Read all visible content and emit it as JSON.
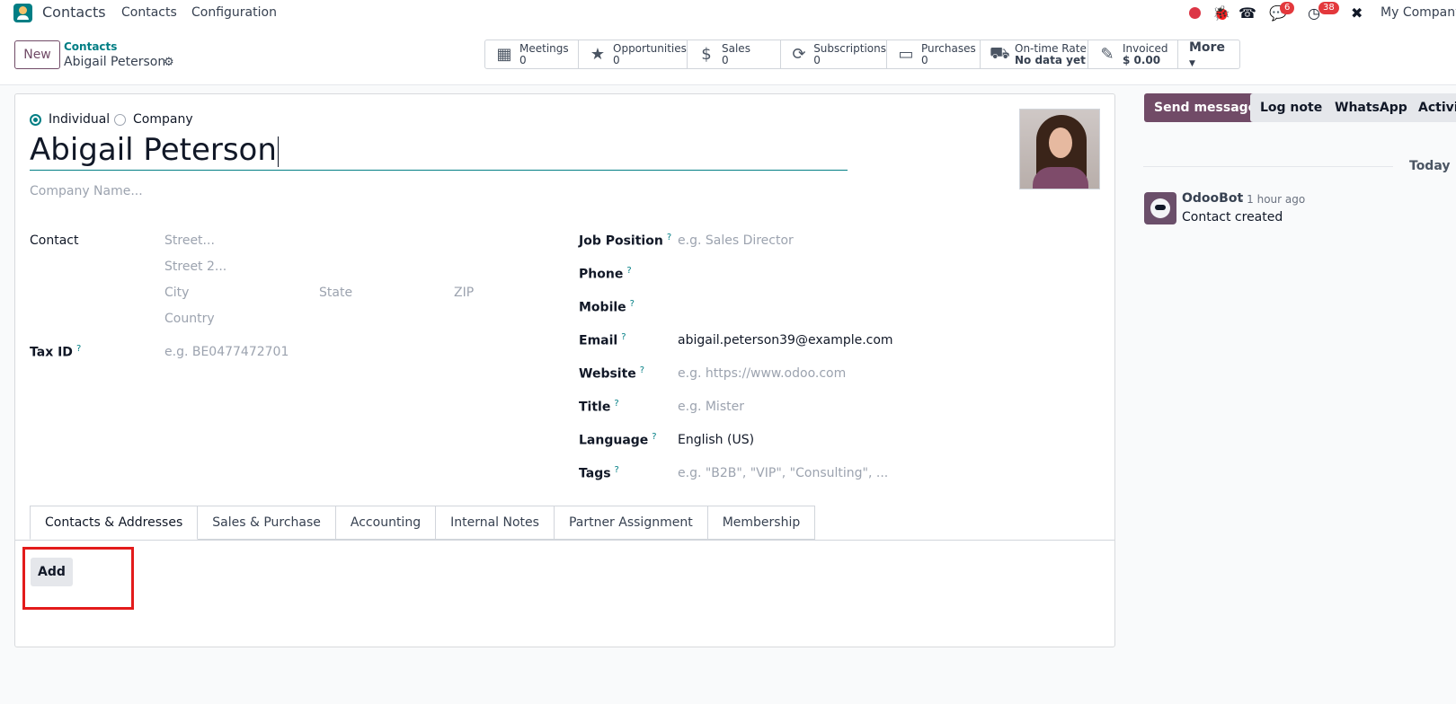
{
  "navbar": {
    "app_name": "Contacts",
    "menus": [
      "Contacts",
      "Configuration"
    ],
    "chat_badge": "6",
    "activity_badge": "38",
    "company": "My Company"
  },
  "control": {
    "new_label": "New",
    "breadcrumb_parent": "Contacts",
    "breadcrumb_current": "Abigail Peterson",
    "smart_buttons": [
      {
        "label": "Meetings",
        "value": "0",
        "icon": "calendar-icon"
      },
      {
        "label": "Opportunities",
        "value": "0",
        "icon": "star-icon"
      },
      {
        "label": "Sales",
        "value": "0",
        "icon": "dollar-icon"
      },
      {
        "label": "Subscriptions",
        "value": "0",
        "icon": "refresh-icon"
      },
      {
        "label": "Purchases",
        "value": "0",
        "icon": "credit-card-icon"
      },
      {
        "label": "On-time Rate",
        "value": "No data yet",
        "icon": "truck-icon"
      },
      {
        "label": "Invoiced",
        "value": "$ 0.00",
        "icon": "pencil-square-icon"
      }
    ],
    "more_label": "More"
  },
  "form": {
    "type_individual": "Individual",
    "type_company": "Company",
    "name": "Abigail Peterson",
    "company_placeholder": "Company Name...",
    "left": {
      "contact_label": "Contact",
      "street_ph": "Street...",
      "street2_ph": "Street 2...",
      "city_ph": "City",
      "state_ph": "State",
      "zip_ph": "ZIP",
      "country_ph": "Country",
      "taxid_label": "Tax ID",
      "taxid_ph": "e.g. BE0477472701"
    },
    "right": {
      "job_label": "Job Position",
      "job_ph": "e.g. Sales Director",
      "phone_label": "Phone",
      "mobile_label": "Mobile",
      "email_label": "Email",
      "email_value": "abigail.peterson39@example.com",
      "website_label": "Website",
      "website_ph": "e.g. https://www.odoo.com",
      "title_label": "Title",
      "title_ph": "e.g. Mister",
      "language_label": "Language",
      "language_value": "English (US)",
      "tags_label": "Tags",
      "tags_ph": "e.g. \"B2B\", \"VIP\", \"Consulting\", ..."
    },
    "qmark": "?",
    "tabs": [
      "Contacts & Addresses",
      "Sales & Purchase",
      "Accounting",
      "Internal Notes",
      "Partner Assignment",
      "Membership"
    ],
    "add_label": "Add"
  },
  "chatter": {
    "send_message": "Send message",
    "log_note": "Log note",
    "whatsapp": "WhatsApp",
    "activities": "Activities",
    "today": "Today",
    "author": "OdooBot",
    "time": "- 1 hour ago",
    "body": "Contact created"
  },
  "colors": {
    "brand": "#714b67",
    "accent": "#017e84",
    "highlight": "#e31b1b"
  }
}
